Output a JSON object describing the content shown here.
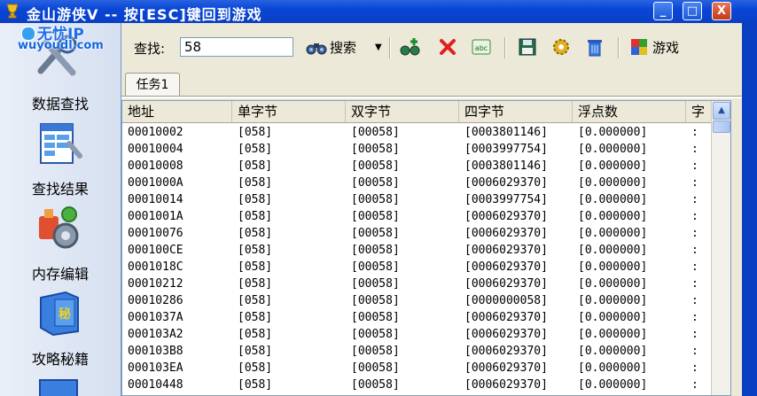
{
  "window": {
    "title": "金山游侠V -- 按[ESC]键回到游戏",
    "buttons": [
      "_",
      "□",
      "X"
    ]
  },
  "watermark": {
    "brand": "无忧IP",
    "url": "wuyoudl.com"
  },
  "sidebar": {
    "items": [
      {
        "label": "数据查找",
        "icon": "magnifier-tools-icon"
      },
      {
        "label": "查找结果",
        "icon": "document-results-icon"
      },
      {
        "label": "内存编辑",
        "icon": "gears-icon"
      },
      {
        "label": "攻略秘籍",
        "icon": "secret-book-icon"
      }
    ]
  },
  "toolbar": {
    "search_label": "查找:",
    "search_value": "58",
    "search_button": "搜索",
    "game_button": "游戏"
  },
  "tabs": [
    "任务1"
  ],
  "table": {
    "columns": [
      "地址",
      "单字节",
      "双字节",
      "四字节",
      "浮点数",
      "字"
    ],
    "rows": [
      [
        "00010002",
        "[058]",
        "[00058]",
        "[0003801146]",
        "[0.000000]",
        ":"
      ],
      [
        "00010004",
        "[058]",
        "[00058]",
        "[0003997754]",
        "[0.000000]",
        ":"
      ],
      [
        "00010008",
        "[058]",
        "[00058]",
        "[0003801146]",
        "[0.000000]",
        ":"
      ],
      [
        "0001000A",
        "[058]",
        "[00058]",
        "[0006029370]",
        "[0.000000]",
        ":"
      ],
      [
        "00010014",
        "[058]",
        "[00058]",
        "[0003997754]",
        "[0.000000]",
        ":"
      ],
      [
        "0001001A",
        "[058]",
        "[00058]",
        "[0006029370]",
        "[0.000000]",
        ":"
      ],
      [
        "00010076",
        "[058]",
        "[00058]",
        "[0006029370]",
        "[0.000000]",
        ":"
      ],
      [
        "000100CE",
        "[058]",
        "[00058]",
        "[0006029370]",
        "[0.000000]",
        ":"
      ],
      [
        "0001018C",
        "[058]",
        "[00058]",
        "[0006029370]",
        "[0.000000]",
        ":"
      ],
      [
        "00010212",
        "[058]",
        "[00058]",
        "[0006029370]",
        "[0.000000]",
        ":"
      ],
      [
        "00010286",
        "[058]",
        "[00058]",
        "[0000000058]",
        "[0.000000]",
        ":"
      ],
      [
        "0001037A",
        "[058]",
        "[00058]",
        "[0006029370]",
        "[0.000000]",
        ":"
      ],
      [
        "000103A2",
        "[058]",
        "[00058]",
        "[0006029370]",
        "[0.000000]",
        ":"
      ],
      [
        "000103B8",
        "[058]",
        "[00058]",
        "[0006029370]",
        "[0.000000]",
        ":"
      ],
      [
        "000103EA",
        "[058]",
        "[00058]",
        "[0006029370]",
        "[0.000000]",
        ":"
      ],
      [
        "00010448",
        "[058]",
        "[00058]",
        "[0006029370]",
        "[0.000000]",
        ":"
      ]
    ]
  },
  "colors": {
    "titlebar": "#0846d6",
    "window_bg": "#ece9d8",
    "sidebar_bg": "#e4eaf6",
    "close_button": "#c23a1a"
  }
}
